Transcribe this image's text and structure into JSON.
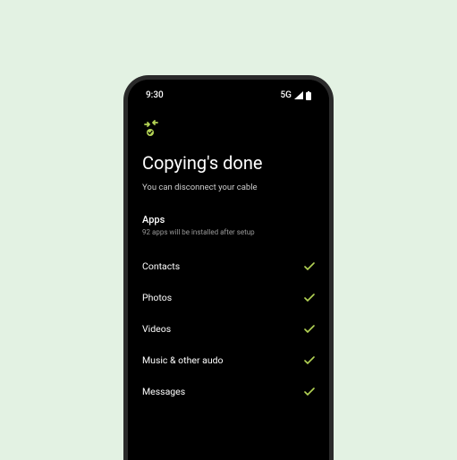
{
  "status": {
    "time": "9:30",
    "network": "5G"
  },
  "icon": "transfer-complete",
  "title": "Copying's done",
  "subtitle": "You can disconnect your cable",
  "apps": {
    "header": "Apps",
    "detail": "92 apps will be installed after setup"
  },
  "items": [
    {
      "label": "Contacts",
      "done": true
    },
    {
      "label": "Photos",
      "done": true
    },
    {
      "label": "Videos",
      "done": true
    },
    {
      "label": "Music & other audo",
      "done": true
    },
    {
      "label": "Messages",
      "done": true
    }
  ],
  "accent_color": "#b4d455"
}
